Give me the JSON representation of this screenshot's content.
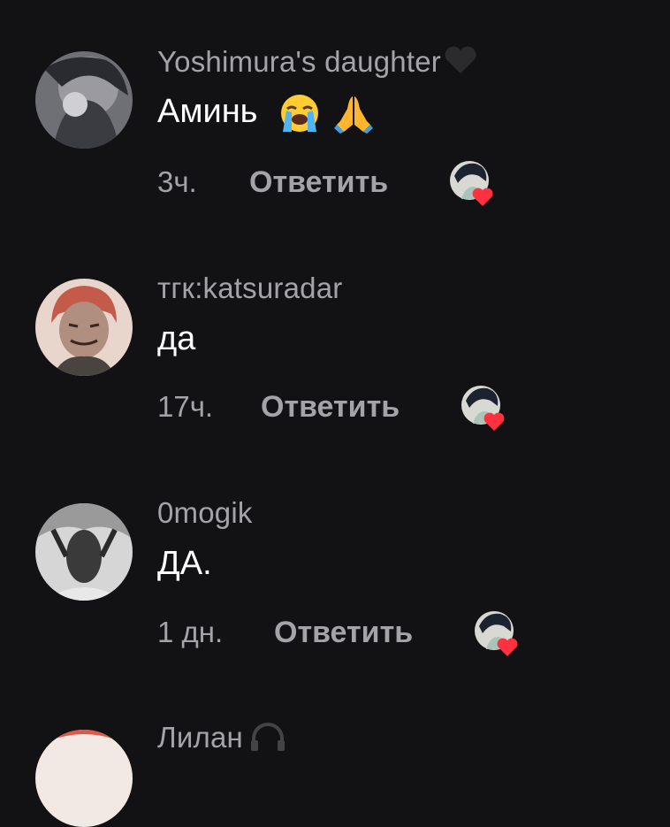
{
  "comments": [
    {
      "username": "Yoshimura's daughter",
      "username_suffix": "🖤",
      "text": "Аминь",
      "emojis": [
        "loudly-crying-face",
        "folded-hands"
      ],
      "time": "3ч.",
      "reply_label": "Ответить",
      "author_liked": true
    },
    {
      "username": "тгк:katsuradar",
      "text": "да",
      "time": "17ч.",
      "reply_label": "Ответить",
      "author_liked": true
    },
    {
      "username": "0mogik",
      "text": "ДА.",
      "time": "1 дн.",
      "reply_label": "Ответить",
      "author_liked": true
    },
    {
      "username": "Лилан",
      "username_suffix": "🎧"
    }
  ],
  "colors": {
    "background": "#121214",
    "secondary_text": "#a4a4a8",
    "primary_text": "#ffffff",
    "heart": "#ff3040"
  }
}
